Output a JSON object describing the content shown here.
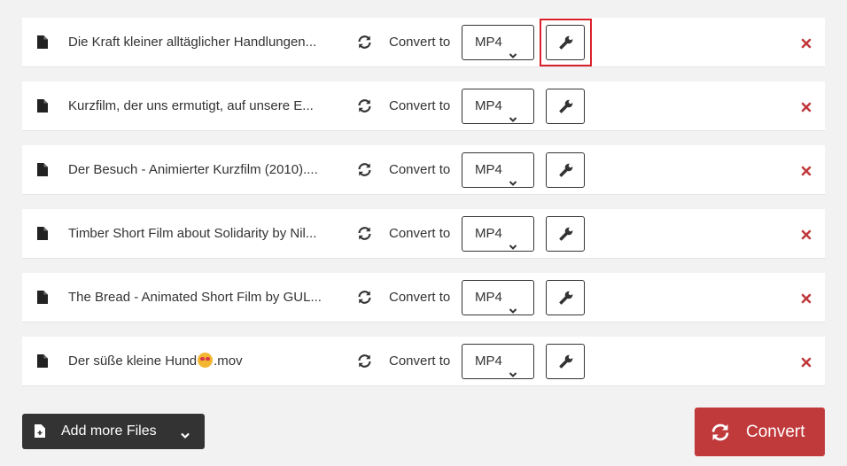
{
  "files": [
    {
      "name": "Die Kraft kleiner alltäglicher Handlungen...",
      "convert_label": "Convert to",
      "format": "MP4"
    },
    {
      "name": "Kurzfilm, der uns ermutigt, auf unsere E...",
      "convert_label": "Convert to",
      "format": "MP4"
    },
    {
      "name": "Der Besuch - Animierter Kurzfilm (2010)....",
      "convert_label": "Convert to",
      "format": "MP4"
    },
    {
      "name": "Timber Short Film about Solidarity by Nil...",
      "convert_label": "Convert to",
      "format": "MP4"
    },
    {
      "name": "The Bread - Animated Short Film by GUL...",
      "convert_label": "Convert to",
      "format": "MP4"
    },
    {
      "name_prefix": "Der süße kleine Hund",
      "name_suffix": ".mov",
      "emoji_icon": "smiling-face-with-heart-eyes-icon",
      "convert_label": "Convert to",
      "format": "MP4"
    }
  ],
  "footer": {
    "add_files_label": "Add more Files",
    "convert_label": "Convert"
  },
  "colors": {
    "background": "#f2f2f2",
    "row": "#ffffff",
    "remove": "#c0393b",
    "convert_button": "#c0393b",
    "add_button": "#333333",
    "highlight": "#d9202a"
  }
}
